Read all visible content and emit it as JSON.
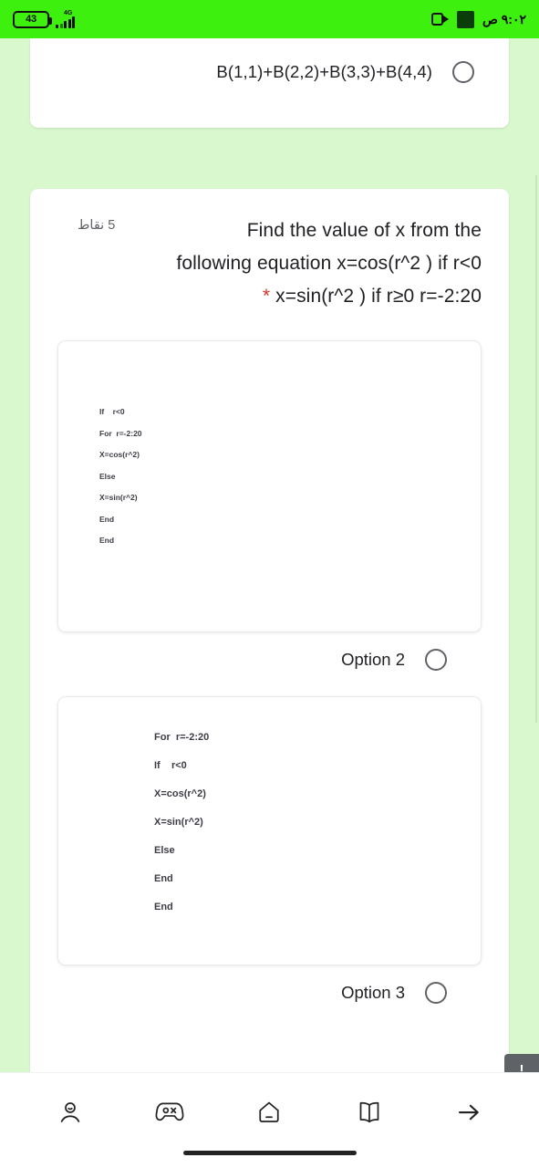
{
  "status_bar": {
    "battery_level": "43",
    "network_type": "4G",
    "time": "٩:٠٢ ص",
    "icons": [
      "battery-icon",
      "signal-bars-icon",
      "screen-record-icon",
      "camera-icon"
    ]
  },
  "previous_question": {
    "option_text": "B(1,1)+B(2,2)+B(3,3)+B(4,4)",
    "selected": false
  },
  "question": {
    "points_label": "5 نقاط",
    "required_marker": "*",
    "text_line1": "Find the value of x from the",
    "text_line2": "following equation x=cos(r^2 ) if r<0",
    "text_line3": "x=sin(r^2 ) if r≥0 r=-2:20",
    "full_text": "Find the value of x from the following equation x=cos(r^2 ) if r<0 * x=sin(r^2 ) if r≥0 r=-2:20"
  },
  "options": [
    {
      "label": "Option 2",
      "selected": false,
      "code_lines": [
        "If    r<0",
        "For  r=-2:20",
        "X=cos(r^2)",
        "Else",
        "X=sin(r^2)",
        "End",
        "End"
      ]
    },
    {
      "label": "Option 3",
      "selected": false,
      "code_lines": [
        "For  r=-2:20",
        "If    r<0",
        "X=cos(r^2)",
        "X=sin(r^2)",
        "Else",
        "End",
        "End"
      ]
    }
  ],
  "required_badge": {
    "glyph": "!"
  },
  "bottom_nav": {
    "items": [
      {
        "name": "profile-icon"
      },
      {
        "name": "gamepad-icon"
      },
      {
        "name": "home-icon"
      },
      {
        "name": "book-icon"
      },
      {
        "name": "arrow-right-icon"
      }
    ]
  },
  "colors": {
    "status_bar_green": "#3ef00d",
    "page_background": "#d9f8cd",
    "card_white": "#ffffff",
    "text_primary": "#202124",
    "text_secondary": "#5f6368",
    "required_red": "#d93025"
  }
}
